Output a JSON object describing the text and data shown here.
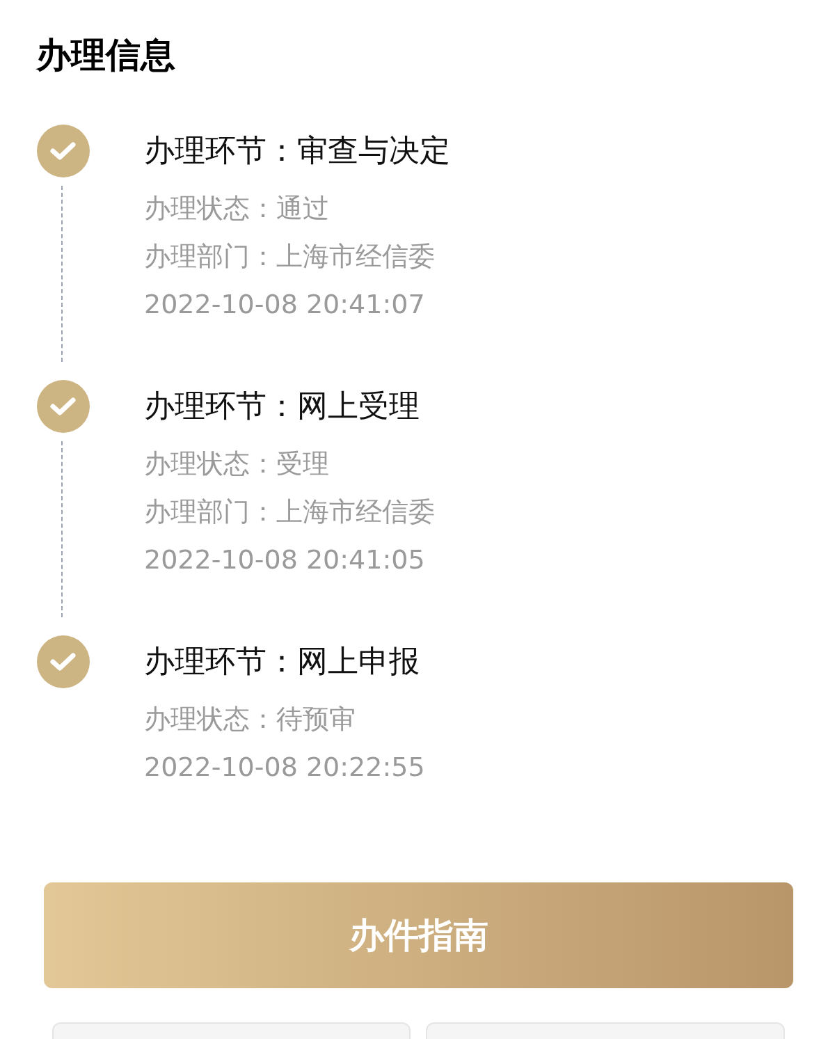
{
  "title": "办理信息",
  "steps": [
    {
      "done": true,
      "heading": "办理环节：审查与决定",
      "details": [
        "办理状态：通过",
        "办理部门：上海市经信委",
        "2022-10-08 20:41:07"
      ]
    },
    {
      "done": true,
      "heading": "办理环节：网上受理",
      "details": [
        "办理状态：受理",
        "办理部门：上海市经信委",
        "2022-10-08 20:41:05"
      ]
    },
    {
      "done": true,
      "heading": "办理环节：网上申报",
      "details": [
        "办理状态：待预审",
        "2022-10-08 20:22:55"
      ]
    }
  ],
  "button": "办件指南"
}
